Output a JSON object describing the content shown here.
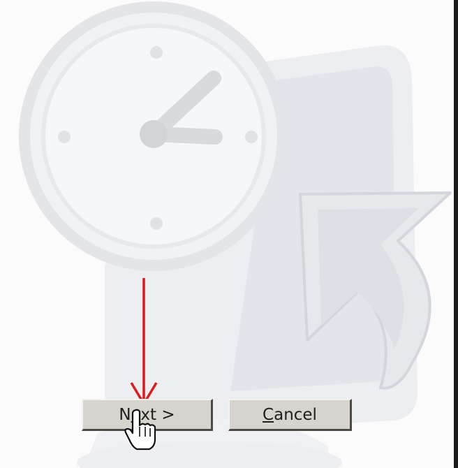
{
  "buttons": {
    "next_label": "Next >",
    "next_mnemonic": "e",
    "cancel_label": "Cancel",
    "cancel_mnemonic": "C"
  },
  "annotation": {
    "arrow_color": "#e01a1a"
  },
  "icons": {
    "background": "clock-monitor-shortcut-watermark",
    "pointer": "hand-pointer-icon"
  }
}
